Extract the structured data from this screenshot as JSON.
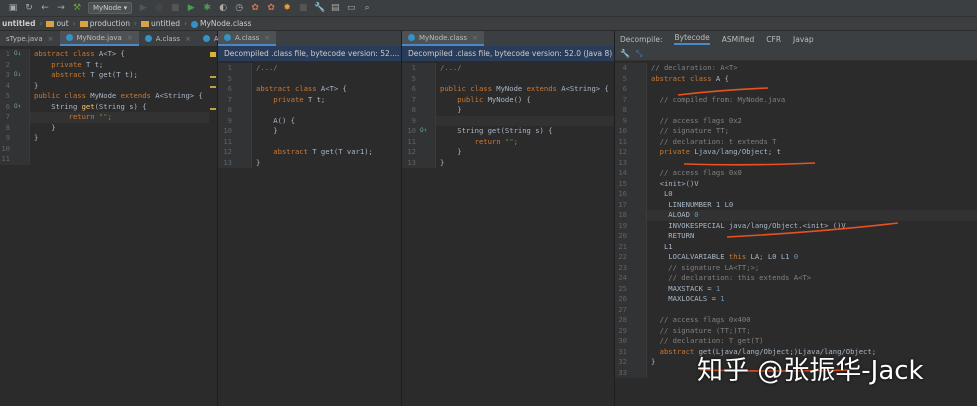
{
  "toolbar": {
    "run_config": "MyNode",
    "icons": [
      "save-icon",
      "sync-icon",
      "back-icon",
      "forward-icon",
      "build-icon",
      "run-icon",
      "debug-icon",
      "coverage-icon",
      "profile-icon",
      "stop-icon",
      "settings-icon",
      "structure-icon",
      "terminal-icon",
      "search-icon"
    ]
  },
  "breadcrumb": [
    "untitled",
    "out",
    "production",
    "untitled",
    "MyNode.class"
  ],
  "left_pane": {
    "tabs": [
      "sType.java",
      "MyNode.java",
      "A.class",
      "A"
    ],
    "active": 1,
    "lines": [
      {
        "n": "1",
        "g": "O↓",
        "t": [
          [
            "k",
            "abstract class "
          ],
          [
            "",
            "A<T> {"
          ]
        ]
      },
      {
        "n": "2",
        "t": [
          [
            "k",
            "    private "
          ],
          [
            "",
            "T t;"
          ]
        ]
      },
      {
        "n": "3",
        "g": "O↓",
        "t": [
          [
            "k",
            "    abstract "
          ],
          [
            "",
            "T get(T t);"
          ]
        ]
      },
      {
        "n": "4",
        "t": [
          [
            "",
            "}"
          ]
        ]
      },
      {
        "n": "5",
        "t": [
          [
            "k",
            "public class "
          ],
          [
            "",
            "MyNode "
          ],
          [
            "k",
            "extends "
          ],
          [
            "",
            "A<String> {"
          ]
        ]
      },
      {
        "n": "6",
        "g": "O↑",
        "t": [
          [
            "",
            "    String "
          ],
          [
            "m",
            "get"
          ],
          [
            "",
            "(String s) {"
          ]
        ]
      },
      {
        "n": "7",
        "cur": true,
        "t": [
          [
            "k",
            "        return "
          ],
          [
            "s",
            "\"\""
          ],
          [
            "k",
            ";"
          ]
        ]
      },
      {
        "n": "8",
        "t": [
          [
            "",
            "    }"
          ]
        ]
      },
      {
        "n": "9",
        "t": [
          [
            "",
            "}"
          ]
        ]
      },
      {
        "n": "10",
        "t": []
      },
      {
        "n": "11",
        "t": []
      }
    ]
  },
  "mid_pane": {
    "tab": "A.class",
    "info": "Decompiled .class file, bytecode version: 52....",
    "lines": [
      {
        "n": "1",
        "t": [
          [
            "c",
            "/.../"
          ]
        ]
      },
      {
        "n": "5",
        "t": []
      },
      {
        "n": "6",
        "t": [
          [
            "k",
            "abstract class "
          ],
          [
            "",
            "A<T> {"
          ]
        ]
      },
      {
        "n": "7",
        "t": [
          [
            "k",
            "    private "
          ],
          [
            "",
            "T t;"
          ]
        ]
      },
      {
        "n": "8",
        "t": []
      },
      {
        "n": "9",
        "t": [
          [
            "",
            "    A() {"
          ]
        ]
      },
      {
        "n": "10",
        "t": [
          [
            "",
            "    }"
          ]
        ]
      },
      {
        "n": "11",
        "t": []
      },
      {
        "n": "12",
        "t": [
          [
            "k",
            "    abstract "
          ],
          [
            "",
            "T get(T var1);"
          ]
        ]
      },
      {
        "n": "13",
        "t": [
          [
            "",
            "}"
          ]
        ]
      }
    ]
  },
  "node_pane": {
    "tab": "MyNode.class",
    "info": "Decompiled .class file, bytecode version: 52.0 (Java 8)",
    "lines": [
      {
        "n": "1",
        "t": [
          [
            "c",
            "/.../"
          ]
        ]
      },
      {
        "n": "5",
        "t": []
      },
      {
        "n": "6",
        "t": [
          [
            "k",
            "public class "
          ],
          [
            "",
            "MyNode "
          ],
          [
            "k",
            "extends "
          ],
          [
            "",
            "A<String> {"
          ]
        ]
      },
      {
        "n": "7",
        "t": [
          [
            "k",
            "    public "
          ],
          [
            "",
            "MyNode() {"
          ]
        ]
      },
      {
        "n": "8",
        "t": [
          [
            "",
            "    }"
          ]
        ]
      },
      {
        "n": "9",
        "cur": true,
        "t": []
      },
      {
        "n": "10",
        "g": "O↑",
        "t": [
          [
            "",
            "    String get(String s) {"
          ]
        ]
      },
      {
        "n": "11",
        "t": [
          [
            "k",
            "        return "
          ],
          [
            "s",
            "\"\""
          ],
          [
            "k",
            ";"
          ]
        ]
      },
      {
        "n": "12",
        "t": [
          [
            "",
            "    }"
          ]
        ]
      },
      {
        "n": "13",
        "t": [
          [
            "",
            "}"
          ]
        ]
      }
    ]
  },
  "bytecode_pane": {
    "label": "Decompile:",
    "tabs": [
      "Bytecode",
      "ASMified",
      "CFR",
      "Javap"
    ],
    "active": 0,
    "lines": [
      {
        "n": "4",
        "t": [
          [
            "c",
            "// declaration: A<T>"
          ]
        ]
      },
      {
        "n": "5",
        "t": [
          [
            "k",
            "abstract class "
          ],
          [
            "",
            "A {"
          ]
        ]
      },
      {
        "n": "6",
        "t": []
      },
      {
        "n": "7",
        "t": [
          [
            "c",
            "  // compiled from: MyNode.java"
          ]
        ]
      },
      {
        "n": "8",
        "t": []
      },
      {
        "n": "9",
        "t": [
          [
            "c",
            "  // access flags 0x2"
          ]
        ]
      },
      {
        "n": "10",
        "t": [
          [
            "c",
            "  // signature TT;"
          ]
        ]
      },
      {
        "n": "11",
        "t": [
          [
            "c",
            "  // declaration: t extends T"
          ]
        ]
      },
      {
        "n": "12",
        "t": [
          [
            "k",
            "  private "
          ],
          [
            "",
            "Ljava/lang/Object; t"
          ]
        ]
      },
      {
        "n": "13",
        "t": []
      },
      {
        "n": "14",
        "t": [
          [
            "c",
            "  // access flags 0x0"
          ]
        ]
      },
      {
        "n": "15",
        "t": [
          [
            "",
            "  <init>()V"
          ]
        ]
      },
      {
        "n": "16",
        "t": [
          [
            "",
            "   L0"
          ]
        ]
      },
      {
        "n": "17",
        "t": [
          [
            "",
            "    LINENUMBER 1 L0"
          ]
        ]
      },
      {
        "n": "18",
        "cur": true,
        "t": [
          [
            "",
            "    ALOAD "
          ],
          [
            "n",
            "0"
          ]
        ]
      },
      {
        "n": "19",
        "t": [
          [
            "",
            "    INVOKESPECIAL java/lang/Object.<init> ()V"
          ]
        ]
      },
      {
        "n": "20",
        "t": [
          [
            "",
            "    RETURN"
          ]
        ]
      },
      {
        "n": "21",
        "t": [
          [
            "",
            "   L1"
          ]
        ]
      },
      {
        "n": "22",
        "t": [
          [
            "",
            "    LOCALVARIABLE "
          ],
          [
            "k",
            "this "
          ],
          [
            "",
            "LA; L0 L1 "
          ],
          [
            "n",
            "0"
          ]
        ]
      },
      {
        "n": "23",
        "t": [
          [
            "c",
            "    // signature LA<TT;>;"
          ]
        ]
      },
      {
        "n": "24",
        "t": [
          [
            "c",
            "    // declaration: this extends A<T>"
          ]
        ]
      },
      {
        "n": "25",
        "t": [
          [
            "",
            "    MAXSTACK = "
          ],
          [
            "n",
            "1"
          ]
        ]
      },
      {
        "n": "26",
        "t": [
          [
            "",
            "    MAXLOCALS = "
          ],
          [
            "n",
            "1"
          ]
        ]
      },
      {
        "n": "27",
        "t": []
      },
      {
        "n": "28",
        "t": [
          [
            "c",
            "  // access flags 0x400"
          ]
        ]
      },
      {
        "n": "29",
        "t": [
          [
            "c",
            "  // signature (TT;)TT;"
          ]
        ]
      },
      {
        "n": "30",
        "t": [
          [
            "c",
            "  // declaration: T get(T)"
          ]
        ]
      },
      {
        "n": "31",
        "t": [
          [
            "k",
            "  abstract "
          ],
          [
            "",
            "get(Ljava/lang/Object;)Ljava/lang/Object;"
          ]
        ]
      },
      {
        "n": "32",
        "t": [
          [
            "",
            "}"
          ]
        ]
      },
      {
        "n": "33",
        "t": []
      }
    ]
  },
  "watermark": "知乎 @张振华-Jack"
}
